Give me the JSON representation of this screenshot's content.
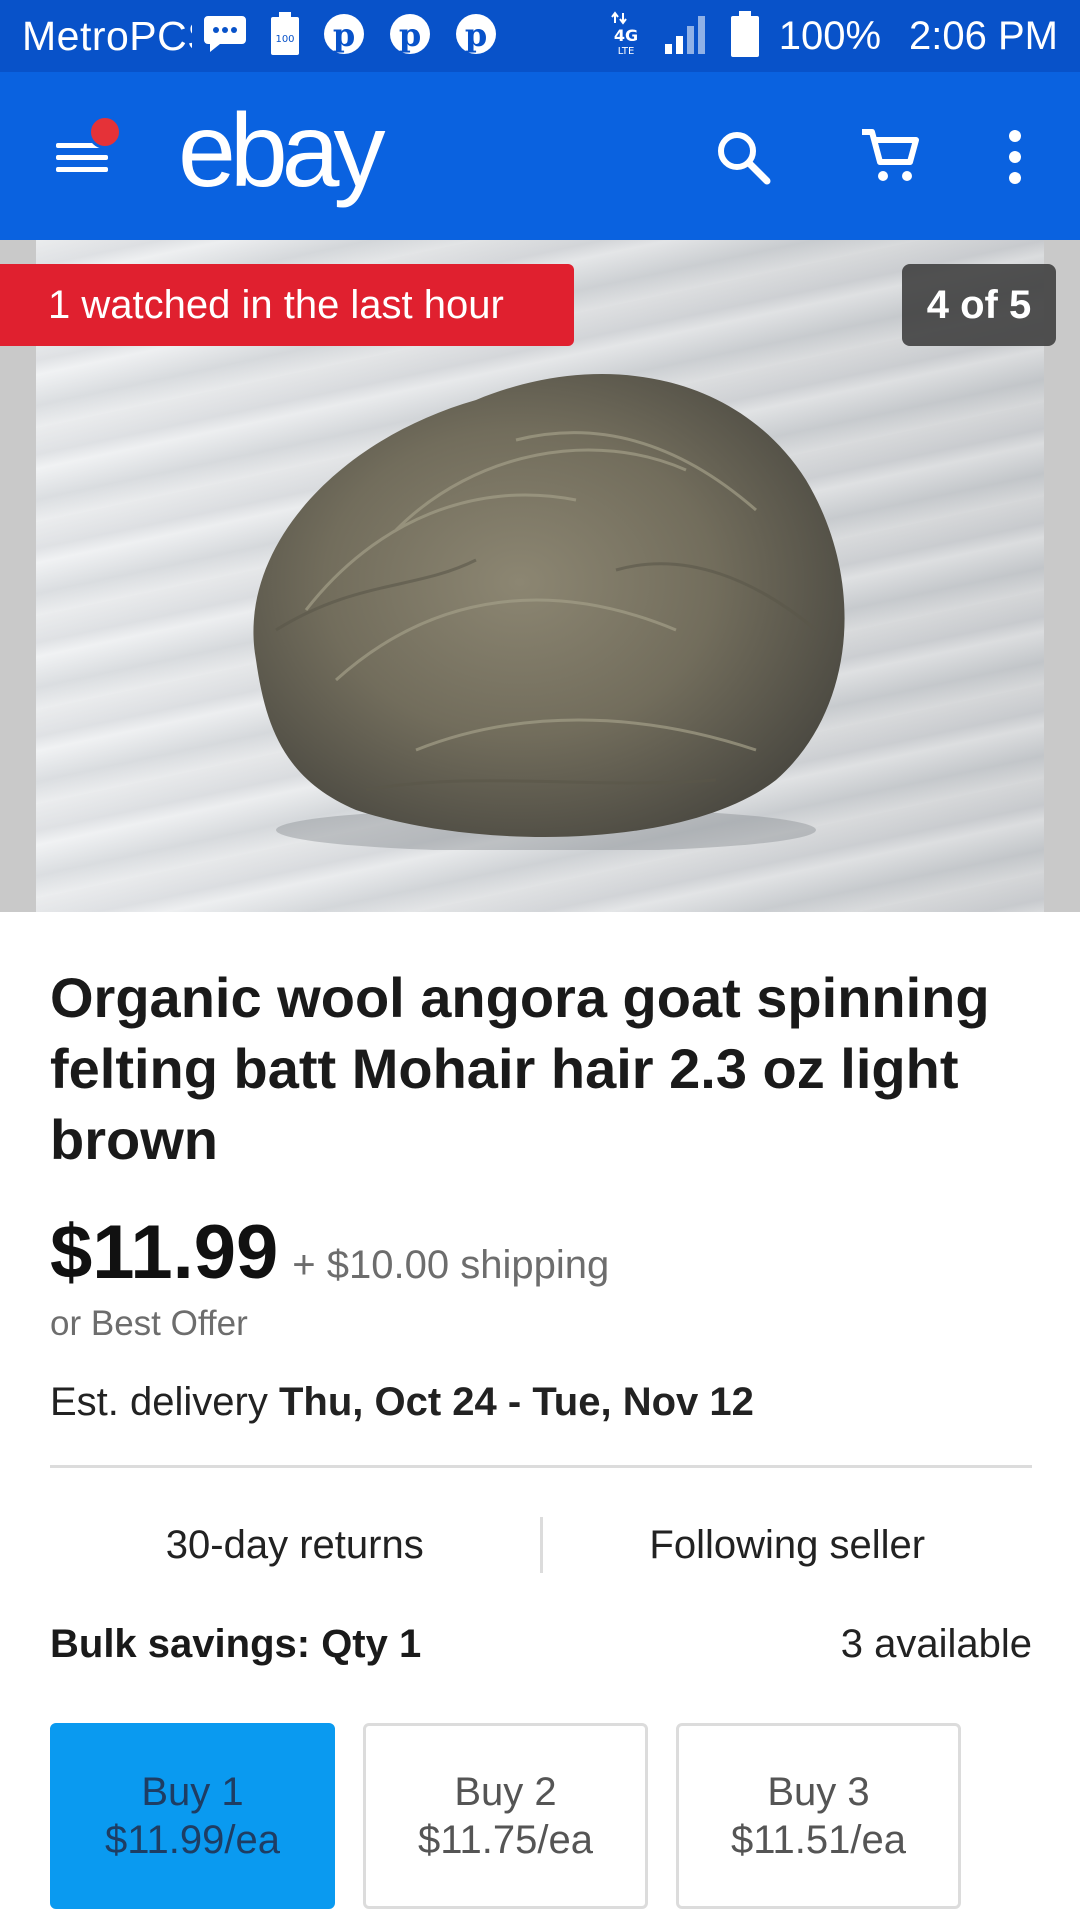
{
  "status_bar": {
    "carrier": "MetroPCS",
    "battery_percent": "100%",
    "time": "2:06 PM",
    "network": "4G LTE"
  },
  "app_bar": {
    "logo": "ebay",
    "notification_dot_color": "#e53238"
  },
  "gallery": {
    "watch_badge": "1 watched in the last hour",
    "image_counter": "4 of 5"
  },
  "item": {
    "title": "Organic wool angora goat spinning felting batt Mohair hair 2.3 oz light brown",
    "price": "$11.99",
    "shipping": "+ $10.00 shipping",
    "best_offer": "or Best Offer",
    "delivery_label": "Est. delivery",
    "delivery_dates": "Thu, Oct 24 - Tue, Nov 12"
  },
  "features": {
    "returns": "30-day returns",
    "seller": "Following seller"
  },
  "bulk": {
    "label": "Bulk savings: Qty 1",
    "available": "3 available",
    "options": [
      {
        "qty": "Buy 1",
        "price": "$11.99/ea"
      },
      {
        "qty": "Buy 2",
        "price": "$11.75/ea"
      },
      {
        "qty": "Buy 3",
        "price": "$11.51/ea"
      }
    ]
  },
  "colors": {
    "status_bar": "#0852c9",
    "app_bar": "#0a62e0",
    "watch_badge": "#e0202f",
    "selected_option": "#0a9af0"
  }
}
